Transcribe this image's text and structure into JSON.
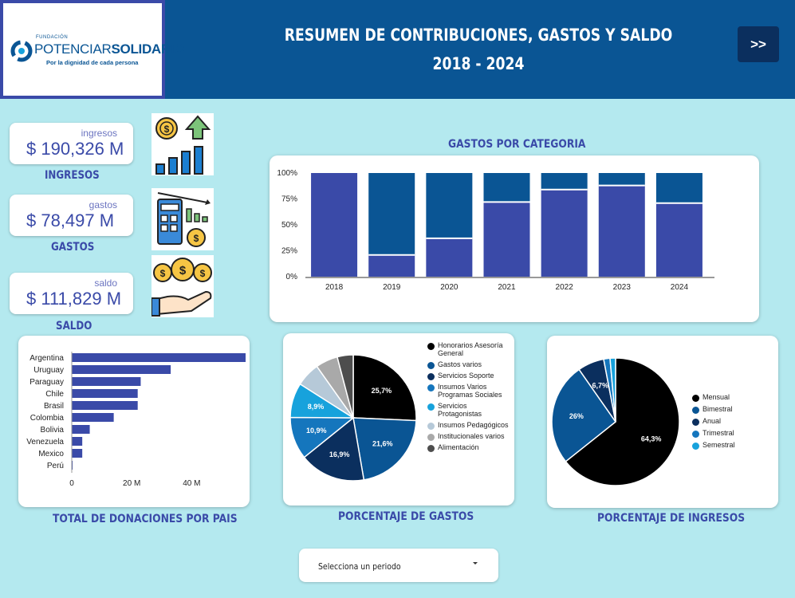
{
  "header": {
    "logo_fund": "FUNDACIÓN",
    "logo_name_a": "POTENCIAR",
    "logo_name_b": "SOLIDARIO",
    "logo_tag": "Por la dignidad de cada persona",
    "title_line1": "RESUMEN DE CONTRIBUCIONES, GASTOS Y SALDO",
    "title_line2": "2018 - 2024",
    "next_label": ">>"
  },
  "kpis": [
    {
      "label": "ingresos",
      "value": "$ 190,326 M",
      "caption": "INGRESOS",
      "icon": "income-growth-icon"
    },
    {
      "label": "gastos",
      "value": "$ 78,497 M",
      "caption": "GASTOS",
      "icon": "calculator-expenses-icon"
    },
    {
      "label": "saldo",
      "value": "$ 111,829 M",
      "caption": "SALDO",
      "icon": "hand-coins-icon"
    }
  ],
  "colors": {
    "header_bg": "#0a5594",
    "page_bg": "#b4e9ef",
    "accent": "#3a4aa8",
    "bar_light": "#3a4aa8",
    "bar_dark": "#0a5594"
  },
  "chart_data": [
    {
      "type": "bar",
      "stacked": "100%",
      "title": "GASTOS POR CATEGORIA",
      "categories": [
        "2018",
        "2019",
        "2020",
        "2021",
        "2022",
        "2023",
        "2024"
      ],
      "series": [
        {
          "values": [
            100,
            21,
            37,
            72,
            84,
            88,
            71
          ],
          "color": "#3a4aa8"
        },
        {
          "values": [
            0,
            79,
            63,
            28,
            16,
            12,
            29
          ],
          "color": "#0a5594"
        }
      ],
      "yticks": [
        "100%",
        "75%",
        "50%",
        "25%",
        "0%"
      ],
      "ylim": [
        0,
        100
      ]
    },
    {
      "type": "bar",
      "orientation": "horizontal",
      "title": "TOTAL DE DONACIONES POR PAIS",
      "categories": [
        "Argentina",
        "Uruguay",
        "Paraguay",
        "Chile",
        "Brasil",
        "Colombia",
        "Bolivia",
        "Venezuela",
        "Mexico",
        "Perú"
      ],
      "values": [
        58,
        33,
        23,
        22,
        22,
        14,
        6,
        3.5,
        3.5,
        0.3
      ],
      "xticks": [
        {
          "v": 0,
          "label": "0"
        },
        {
          "v": 20,
          "label": "20 M"
        },
        {
          "v": 40,
          "label": "40 M"
        }
      ],
      "xlim": [
        0,
        58
      ],
      "color": "#3a4aa8"
    },
    {
      "type": "pie",
      "title": "PORCENTAJE DE GASTOS",
      "slices": [
        {
          "name": "Honorarios Asesoría General",
          "value": 25.7,
          "label": "25,7%",
          "color": "#000000"
        },
        {
          "name": "Gastos varios",
          "value": 21.6,
          "label": "21,6%",
          "color": "#0a5594"
        },
        {
          "name": "Servicios Soporte",
          "value": 16.9,
          "label": "16,9%",
          "color": "#0b2f5e"
        },
        {
          "name": "Insumos Varios Programas Sociales",
          "value": 10.9,
          "label": "10,9%",
          "color": "#1576bd"
        },
        {
          "name": "Servicios Protagonistas",
          "value": 8.9,
          "label": "8,9%",
          "color": "#17a2dc"
        },
        {
          "name": "Insumos Pedagógicos",
          "value": 6.2,
          "label": "",
          "color": "#b6c9d8"
        },
        {
          "name": "Institucionales varios",
          "value": 5.7,
          "label": "",
          "color": "#a9a9a9"
        },
        {
          "name": "Alimentación",
          "value": 4.1,
          "label": "",
          "color": "#4d4d4d"
        }
      ],
      "legend": [
        "Honorarios Asesoría General",
        "Gastos varios",
        "Servicios Soporte",
        "Insumos Varios Programas Sociales",
        "Servicios Protagonistas",
        "Insumos Pedagógicos",
        "Institucionales varios",
        "Alimentación"
      ]
    },
    {
      "type": "pie",
      "title": "PORCENTAJE DE INGRESOS",
      "slices": [
        {
          "name": "Mensual",
          "value": 64.3,
          "label": "64,3%",
          "color": "#000000"
        },
        {
          "name": "Bimestral",
          "value": 26,
          "label": "26%",
          "color": "#0a5594"
        },
        {
          "name": "Anual",
          "value": 6.7,
          "label": "6,7%",
          "color": "#0b2f5e"
        },
        {
          "name": "Trimestral",
          "value": 1.6,
          "label": "",
          "color": "#1576bd"
        },
        {
          "name": "Semestral",
          "value": 1.4,
          "label": "",
          "color": "#17a2dc"
        }
      ],
      "legend": [
        "Mensual",
        "Bimestral",
        "Anual",
        "Trimestral",
        "Semestral"
      ]
    }
  ],
  "period_select": {
    "placeholder": "Selecciona un periodo"
  }
}
